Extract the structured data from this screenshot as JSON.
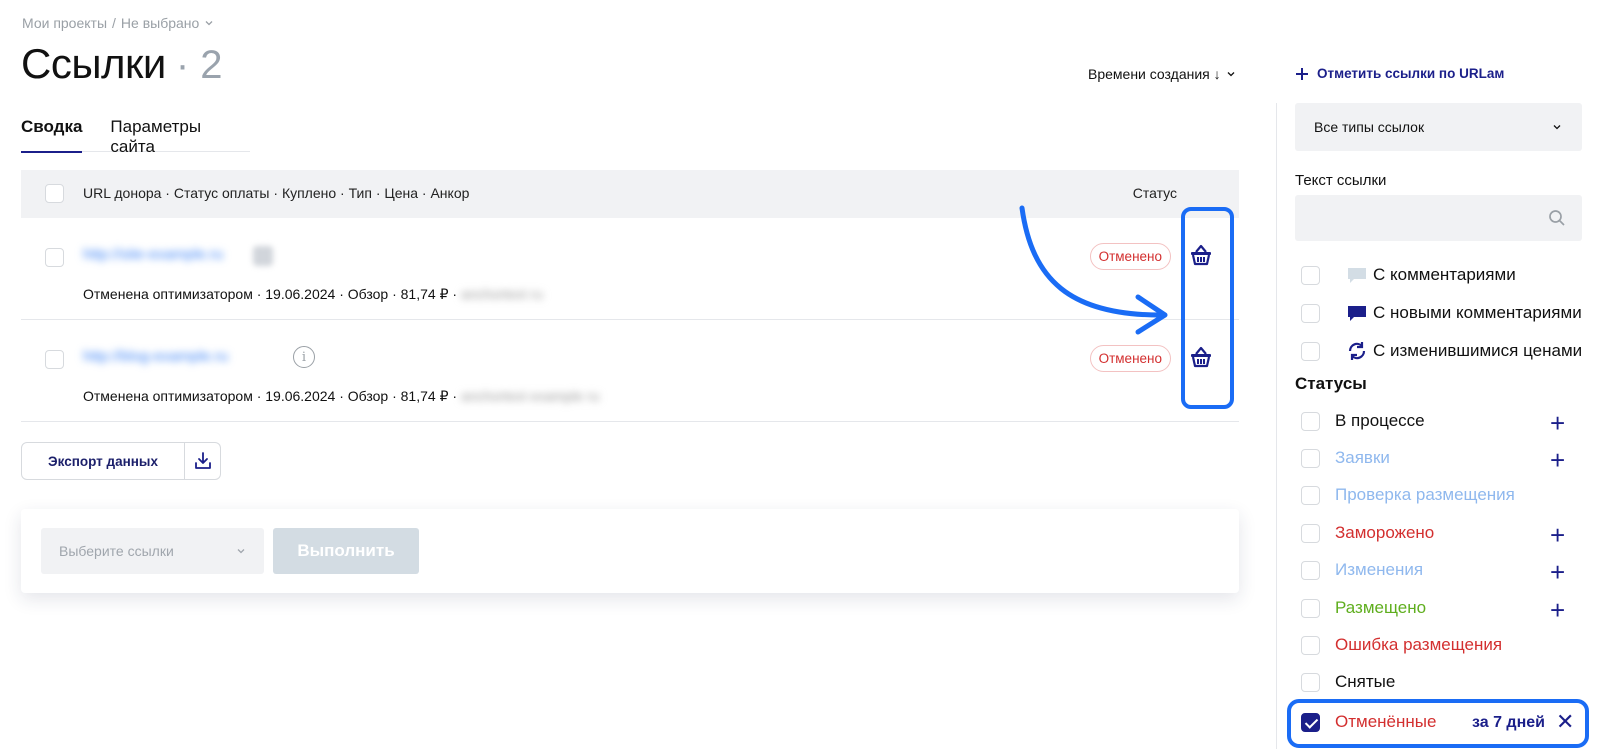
{
  "breadcrumb": {
    "projects": "Мои проекты",
    "separator": "/",
    "current": "Не выбрано"
  },
  "header": {
    "title": "Ссылки",
    "count": "· 2"
  },
  "sort": {
    "label": "Времени создания ↓"
  },
  "tabs": [
    {
      "label": "Сводка",
      "active": true
    },
    {
      "label": "Параметры сайта",
      "active": false
    }
  ],
  "table": {
    "columns_label": "URL донора · Статус оплаты · Куплено · Тип · Цена · Анкор",
    "status_header": "Статус",
    "rows": [
      {
        "url": "http://site-example.ru",
        "meta": "Отменена оптимизатором · 19.06.2024 · Обзор · 81,74 ₽ ·",
        "anchor": "anchortext ru",
        "status": "Отменено",
        "has_info": false
      },
      {
        "url": "http://blog-example.ru",
        "meta": "Отменена оптимизатором · 19.06.2024 · Обзор · 81,74 ₽ ·",
        "anchor": "anchortext example ru",
        "status": "Отменено",
        "has_info": true
      }
    ]
  },
  "export": {
    "label": "Экспорт данных"
  },
  "actions": {
    "select_placeholder": "Выберите ссылки",
    "run_label": "Выполнить"
  },
  "sidebar": {
    "add_url_label": "Отметить ссылки по URLам",
    "type_select": "Все типы ссылок",
    "link_text_label": "Текст ссылки",
    "link_text_value": "",
    "filters": [
      {
        "label": "С комментариями",
        "icon": "comment-icon"
      },
      {
        "label": "С новыми комментариями",
        "icon": "new-comment-icon"
      },
      {
        "label": "С изменившимися ценами",
        "icon": "refresh-icon"
      }
    ],
    "statuses_title": "Статусы",
    "statuses": [
      {
        "label": "В процессе",
        "color": "#111111",
        "plus": true,
        "checked": false
      },
      {
        "label": "Заявки",
        "color": "#8fb8ee",
        "plus": true,
        "checked": false
      },
      {
        "label": "Проверка размещения",
        "color": "#8fb8ee",
        "plus": false,
        "checked": false
      },
      {
        "label": "Заморожено",
        "color": "#d32f2f",
        "plus": true,
        "checked": false
      },
      {
        "label": "Изменения",
        "color": "#8fb8ee",
        "plus": true,
        "checked": false
      },
      {
        "label": "Размещено",
        "color": "#5fae1e",
        "plus": true,
        "checked": false
      },
      {
        "label": "Ошибка размещения",
        "color": "#d32f2f",
        "plus": false,
        "checked": false
      },
      {
        "label": "Снятые",
        "color": "#111111",
        "plus": false,
        "checked": false
      },
      {
        "label": "Отменённые",
        "color": "#d32f2f",
        "plus": false,
        "checked": true
      }
    ],
    "period": "за 7 дней"
  },
  "colors": {
    "accent": "#1b1f8a",
    "highlight": "#1a6cf5",
    "danger": "#d32f2f"
  }
}
